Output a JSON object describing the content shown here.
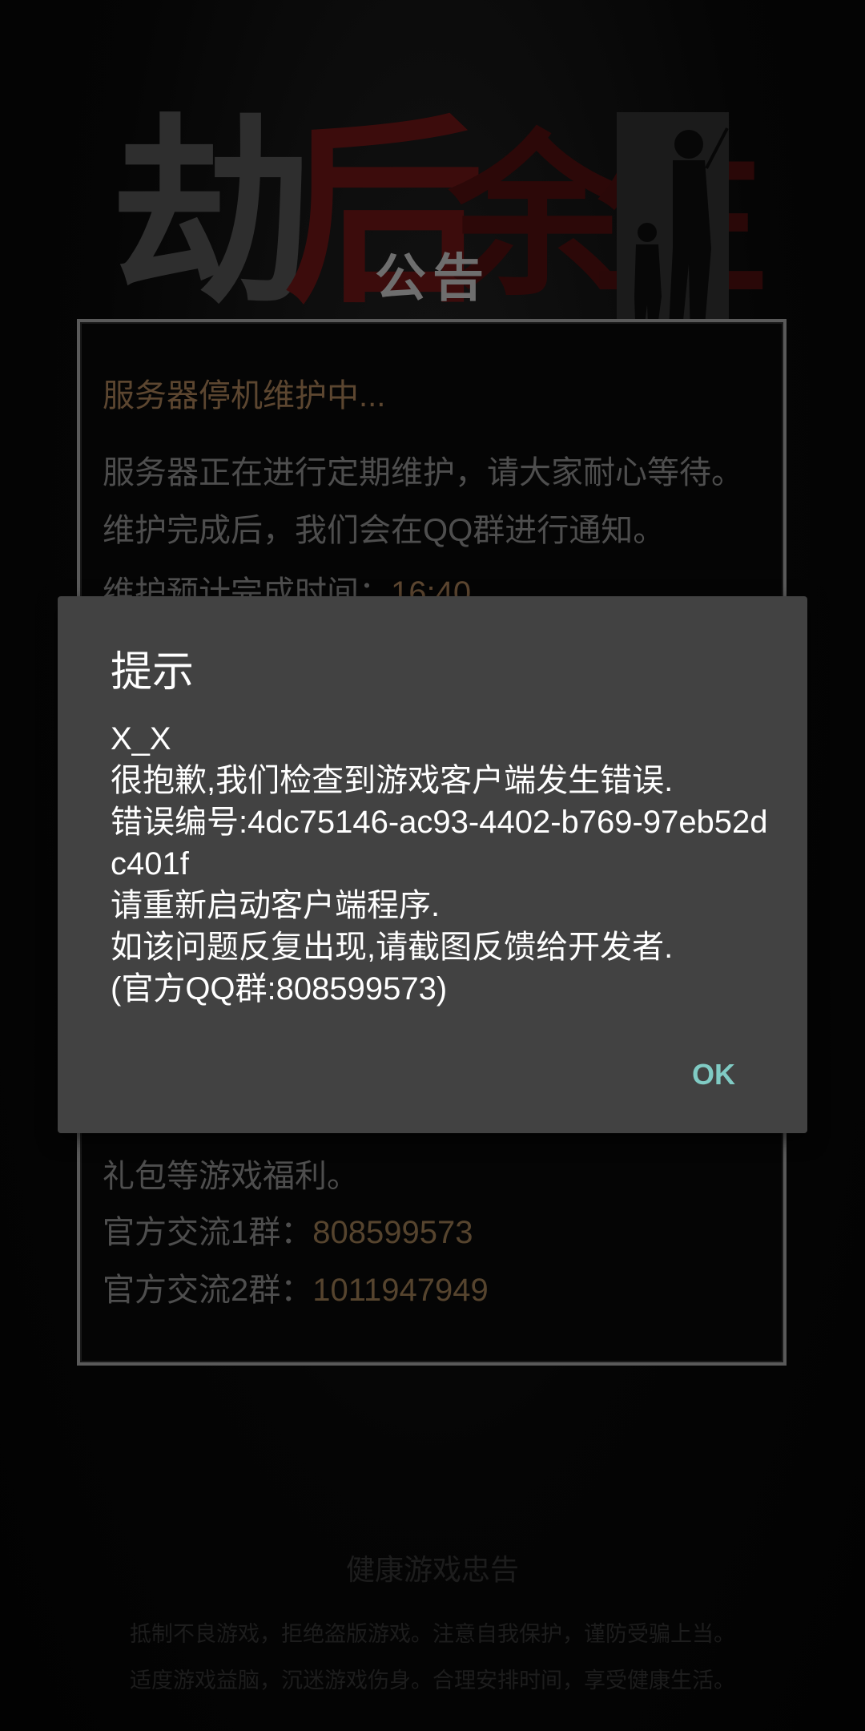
{
  "background": {
    "logo_chars": [
      "劫",
      "后",
      "余",
      "生"
    ],
    "notice_title": "公告",
    "notice": {
      "heading": "服务器停机维护中...",
      "body": "服务器正在进行定期维护，请大家耐心等待。维护完成后，我们会在QQ群进行通知。",
      "eta_label": "维护预计完成时间：",
      "eta_value": "16:40",
      "gifts": "礼包等游戏福利。",
      "group1_label": "官方交流1群：",
      "group1_value": "808599573",
      "group2_label": "官方交流2群：",
      "group2_value": "1011947949"
    },
    "health_title": "健康游戏忠告",
    "health_line1": "抵制不良游戏，拒绝盗版游戏。注意自我保护，谨防受骗上当。",
    "health_line2": "适度游戏益脑，沉迷游戏伤身。合理安排时间，享受健康生活。"
  },
  "dialog": {
    "title": "提示",
    "message": "X_X\n很抱歉,我们检查到游戏客户端发生错误.\n错误编号:4dc75146-ac93-4402-b769-97eb52dc401f\n请重新启动客户端程序.\n如该问题反复出现,请截图反馈给开发者.\n(官方QQ群:808599573)",
    "ok_label": "OK",
    "ok_color": "#80cbc4",
    "background_color": "#424242"
  }
}
